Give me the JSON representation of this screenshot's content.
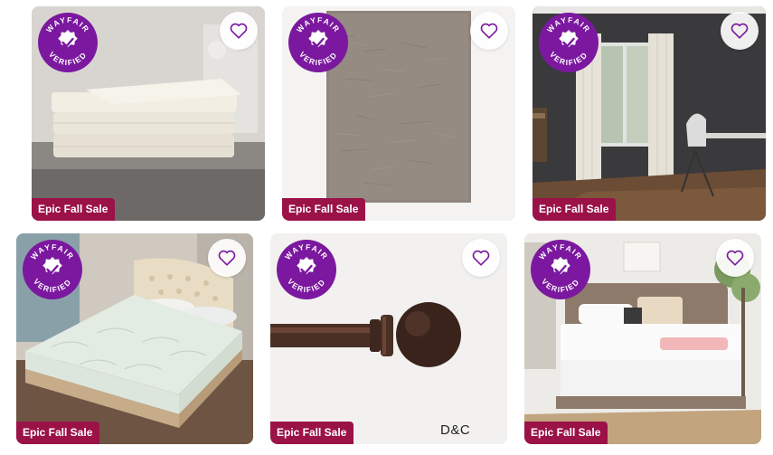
{
  "colors": {
    "sale_tag_bg": "#9b1248",
    "wayfair_purple": "#7b189f",
    "heart_stroke": "#7b189f"
  },
  "badge": {
    "text_top": "WAYFAIR",
    "text_bottom": "VERIFIED"
  },
  "products": [
    {
      "image": "white-bed-sheets",
      "sale_label": "Epic Fall Sale",
      "verified": true
    },
    {
      "image": "gray-area-rug",
      "sale_label": "Epic Fall Sale",
      "verified": true
    },
    {
      "image": "white-curtains-room",
      "sale_label": "Epic Fall Sale",
      "verified": true
    },
    {
      "image": "mattress-protector-bed",
      "sale_label": "Epic Fall Sale",
      "verified": true
    },
    {
      "image": "curtain-rod",
      "sale_label": "Epic Fall Sale",
      "verified": true,
      "brand_text": "D&C"
    },
    {
      "image": "white-mattress-bedroom",
      "sale_label": "Epic Fall Sale",
      "verified": true
    }
  ],
  "icons": {
    "favorite": "heart-outline-icon",
    "verified": "wayfair-verified-icon"
  }
}
